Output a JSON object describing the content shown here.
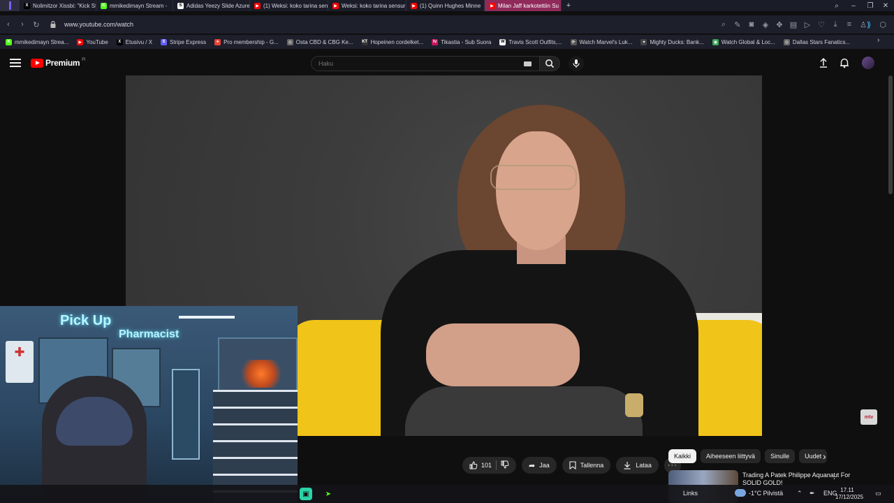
{
  "browser": {
    "tabs": [
      {
        "title": "Nolimitzor Xissbi: \"Kick Str",
        "icon": "x-icon",
        "color": "#000000",
        "glyph": "X",
        "active": false
      },
      {
        "title": "mmikedimayn Stream - ",
        "icon": "kick-icon",
        "color": "#53fc18",
        "glyph": "K",
        "active": false
      },
      {
        "title": "Adidas Yeezy Slide Azure",
        "icon": "stockx-icon",
        "color": "#ffffff",
        "glyph": "S",
        "active": false
      },
      {
        "title": "(1) Weksi: koko tarina sen",
        "icon": "youtube-icon",
        "color": "#ff0000",
        "glyph": "▶",
        "active": false
      },
      {
        "title": "Weksi: koko tarina sensur",
        "icon": "youtube-icon",
        "color": "#ff0000",
        "glyph": "▶",
        "active": false
      },
      {
        "title": "(1) Quinn Hughes Minne",
        "icon": "youtube-icon",
        "color": "#ff0000",
        "glyph": "▶",
        "active": false
      },
      {
        "title": "Milan Jaff karkotettiin Su",
        "icon": "youtube-icon",
        "color": "#ff0000",
        "glyph": "▶",
        "active": true
      }
    ],
    "new_tab": "+",
    "url": "www.youtube.com/watch",
    "bookmarks": [
      {
        "label": "mmikedimayn Strea...",
        "icon": "kick-icon",
        "color": "#53fc18",
        "glyph": "K"
      },
      {
        "label": "YouTube",
        "icon": "youtube-icon",
        "color": "#ff0000",
        "glyph": "▶"
      },
      {
        "label": "Etusivu / X",
        "icon": "x-icon",
        "color": "#000000",
        "glyph": "X"
      },
      {
        "label": "Stripe Express",
        "icon": "stripe-icon",
        "color": "#635bff",
        "glyph": "S"
      },
      {
        "label": "Pro membership - G...",
        "icon": "map-pin-icon",
        "color": "#ea4335",
        "glyph": "●"
      },
      {
        "label": "Osta CBD & CBG Ke...",
        "icon": "globe-icon",
        "color": "#666666",
        "glyph": "◎"
      },
      {
        "label": "Hopeinen cordelket...",
        "icon": "kt-icon",
        "color": "#333333",
        "glyph": "KT"
      },
      {
        "label": "Tikastia - Sub Suora",
        "icon": "tv-icon",
        "color": "#c2185b",
        "glyph": "tv"
      },
      {
        "label": "Travis Scott Outfits,...",
        "icon": "w-icon",
        "color": "#ffffff",
        "glyph": "W"
      },
      {
        "label": "Watch Marvel's Luk...",
        "icon": "link-icon",
        "color": "#555555",
        "glyph": "⟳"
      },
      {
        "label": "Mighty Ducks: Bank...",
        "icon": "duck-icon",
        "color": "#444444",
        "glyph": "✦"
      },
      {
        "label": "Watch Global & Loc...",
        "icon": "green-icon",
        "color": "#3aa757",
        "glyph": "◉"
      },
      {
        "label": "Dallas Stars Fanatics...",
        "icon": "globe-icon",
        "color": "#666666",
        "glyph": "◎"
      }
    ]
  },
  "youtube": {
    "logo_text": "Premium",
    "logo_cc": "FI",
    "search_placeholder": "Haku",
    "actions": {
      "like_count": "101",
      "share": "Jaa",
      "save": "Tallenna",
      "download": "Lataa"
    },
    "chips": [
      {
        "label": "Kaikki",
        "active": true
      },
      {
        "label": "Aiheeseen liittyvä",
        "active": false
      },
      {
        "label": "Sinulle",
        "active": false
      },
      {
        "label": "Uudet",
        "active": false
      }
    ],
    "recommended": [
      {
        "title": "Trading A Patek Philippe Aquanaut For SOLID GOLD!"
      }
    ],
    "channel_watermark": "mtv",
    "cam_sign_1": "Pick Up",
    "cam_sign_2": "Pharmacist"
  },
  "taskbar": {
    "links_label": "Links",
    "weather": "-1°C  Pilvistä",
    "language": "ENG",
    "time": "17.11",
    "date": "17/12/2025"
  }
}
